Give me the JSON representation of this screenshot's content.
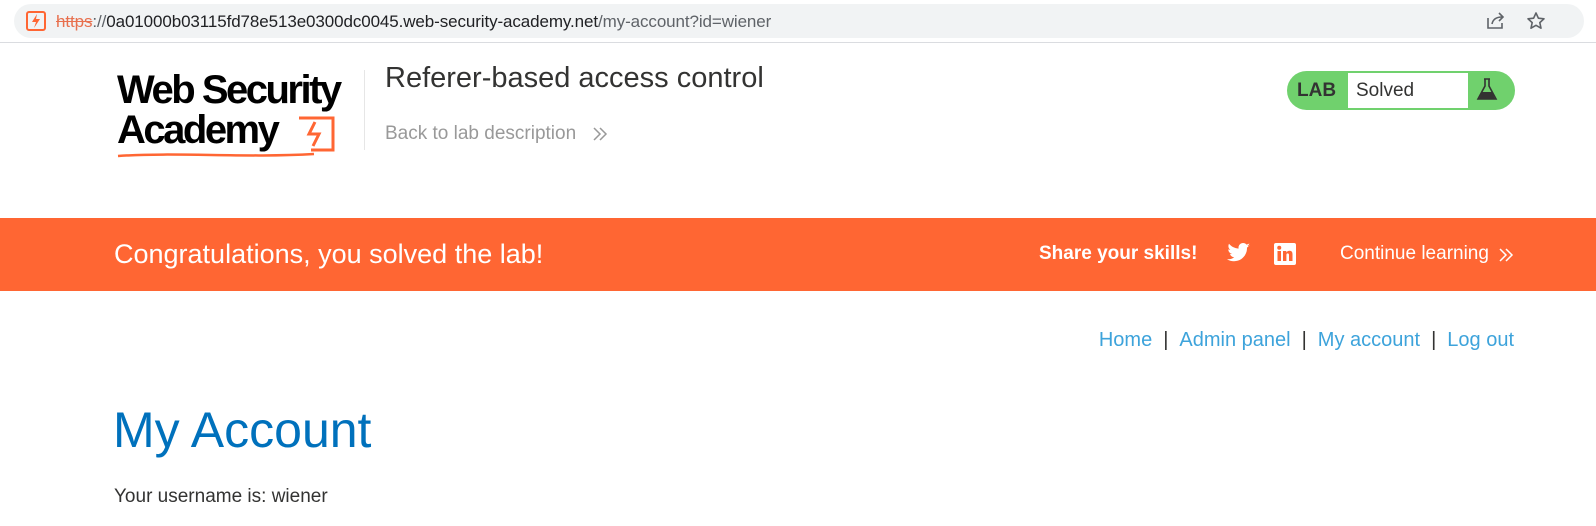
{
  "browser": {
    "url_scheme": "https",
    "url_separator": "://",
    "url_host": "0a01000b03115fd78e513e0300dc0045.web-security-academy.net",
    "url_path": "/my-account?id=wiener",
    "icons": [
      "site-favicon-icon",
      "share-icon",
      "star-icon"
    ]
  },
  "header": {
    "logo_line1": "Web Security",
    "logo_line2": "Academy",
    "lab_title": "Referer-based access control",
    "back_link": "Back to lab description",
    "lab_badge": "LAB",
    "lab_status": "Solved"
  },
  "banner": {
    "message": "Congratulations, you solved the lab!",
    "share_label": "Share your skills!",
    "continue_label": "Continue learning"
  },
  "nav": {
    "home": "Home",
    "admin_panel": "Admin panel",
    "my_account": "My account",
    "log_out": "Log out",
    "separator": "|"
  },
  "main": {
    "heading": "My Account",
    "username_line": "Your username is: wiener"
  },
  "colors": {
    "brand_orange": "#ff6633",
    "solved_green": "#70d16d",
    "link_blue": "#3da3db",
    "heading_blue": "#0071bc"
  }
}
